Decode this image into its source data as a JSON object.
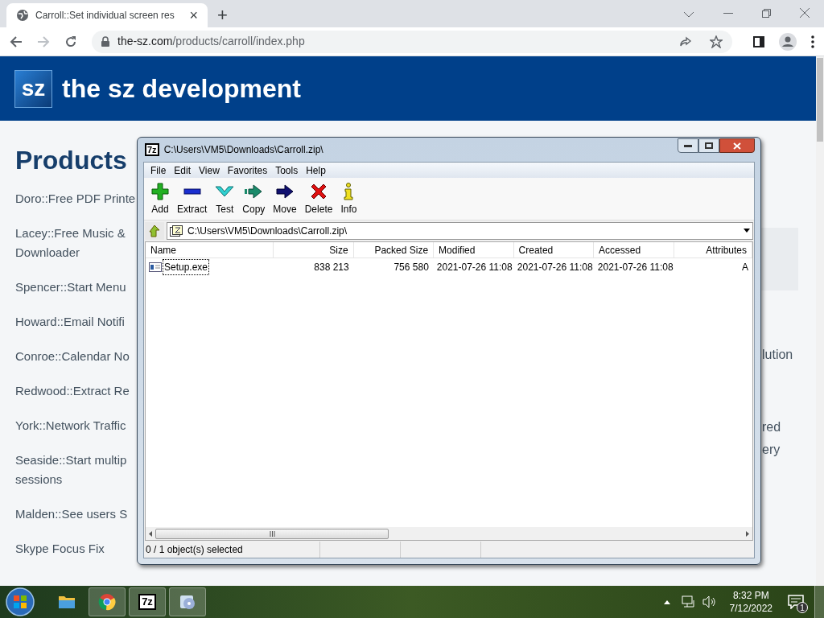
{
  "browser": {
    "tab": {
      "title": "Carroll::Set individual screen res",
      "close": "×",
      "selected": true
    },
    "new_tab": "+",
    "url_host": "the-sz.com",
    "url_path": "/products/carroll/index.php"
  },
  "site": {
    "logo": "sz",
    "title": "the sz development"
  },
  "sidebar": {
    "heading": "Products",
    "items": [
      "Doro::Free PDF Printe",
      "Lacey::Free Music &\nDownloader",
      "Spencer::Start Menu",
      "Howard::Email Notifi",
      "Conroe::Calendar No",
      "Redwood::Extract Re",
      "York::Network Traffic",
      "Seaside::Start multip\nsessions",
      "Malden::See users S",
      "Skype Focus Fix"
    ]
  },
  "content_fragments": [
    "lution",
    "red\nery"
  ],
  "archive_window": {
    "title": "C:\\Users\\VM5\\Downloads\\Carroll.zip\\",
    "app_icon": "7z",
    "menu": [
      "File",
      "Edit",
      "View",
      "Favorites",
      "Tools",
      "Help"
    ],
    "toolbar": [
      {
        "kind": "add",
        "label": "Add"
      },
      {
        "kind": "extract",
        "label": "Extract"
      },
      {
        "kind": "test",
        "label": "Test"
      },
      {
        "kind": "copy",
        "label": "Copy"
      },
      {
        "kind": "move",
        "label": "Move"
      },
      {
        "kind": "delete",
        "label": "Delete"
      },
      {
        "kind": "info",
        "label": "Info"
      }
    ],
    "address": "C:\\Users\\VM5\\Downloads\\Carroll.zip\\",
    "table": {
      "columns": [
        "Name",
        "Size",
        "Packed Size",
        "Modified",
        "Created",
        "Accessed",
        "Attributes"
      ],
      "rows": [
        {
          "cells": [
            "Setup.exe",
            "838 213",
            "756 580",
            "2021-07-26 11:08",
            "2021-07-26 11:08",
            "2021-07-26 11:08",
            "A"
          ],
          "focused": true
        }
      ]
    },
    "status_bar": [
      "0 / 1 object(s) selected"
    ]
  },
  "taskbar": {
    "apps": [
      {
        "kind": "folder",
        "active": false
      },
      {
        "kind": "chrome",
        "active": true
      },
      {
        "kind": "sevenzip",
        "label": "7z",
        "active": true
      },
      {
        "kind": "disc",
        "active": true
      }
    ],
    "time": "8:32 PM",
    "date": "7/12/2022",
    "notifications": "1"
  }
}
